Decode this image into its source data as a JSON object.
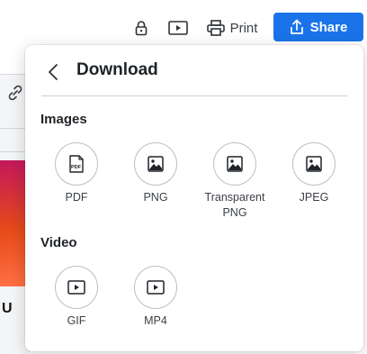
{
  "toolbar": {
    "print_label": "Print",
    "share_label": "Share",
    "accent_color": "#1a73e8"
  },
  "canvas": {
    "art_text": "U"
  },
  "download_panel": {
    "title": "Download",
    "images_section": {
      "title": "Images",
      "options": [
        {
          "label": "PDF",
          "icon": "pdf-file-icon"
        },
        {
          "label": "PNG",
          "icon": "image-icon"
        },
        {
          "label": "Transparent PNG",
          "icon": "image-icon"
        },
        {
          "label": "JPEG",
          "icon": "image-icon"
        }
      ]
    },
    "video_section": {
      "title": "Video",
      "options": [
        {
          "label": "GIF",
          "icon": "play-icon"
        },
        {
          "label": "MP4",
          "icon": "play-icon"
        }
      ]
    }
  }
}
